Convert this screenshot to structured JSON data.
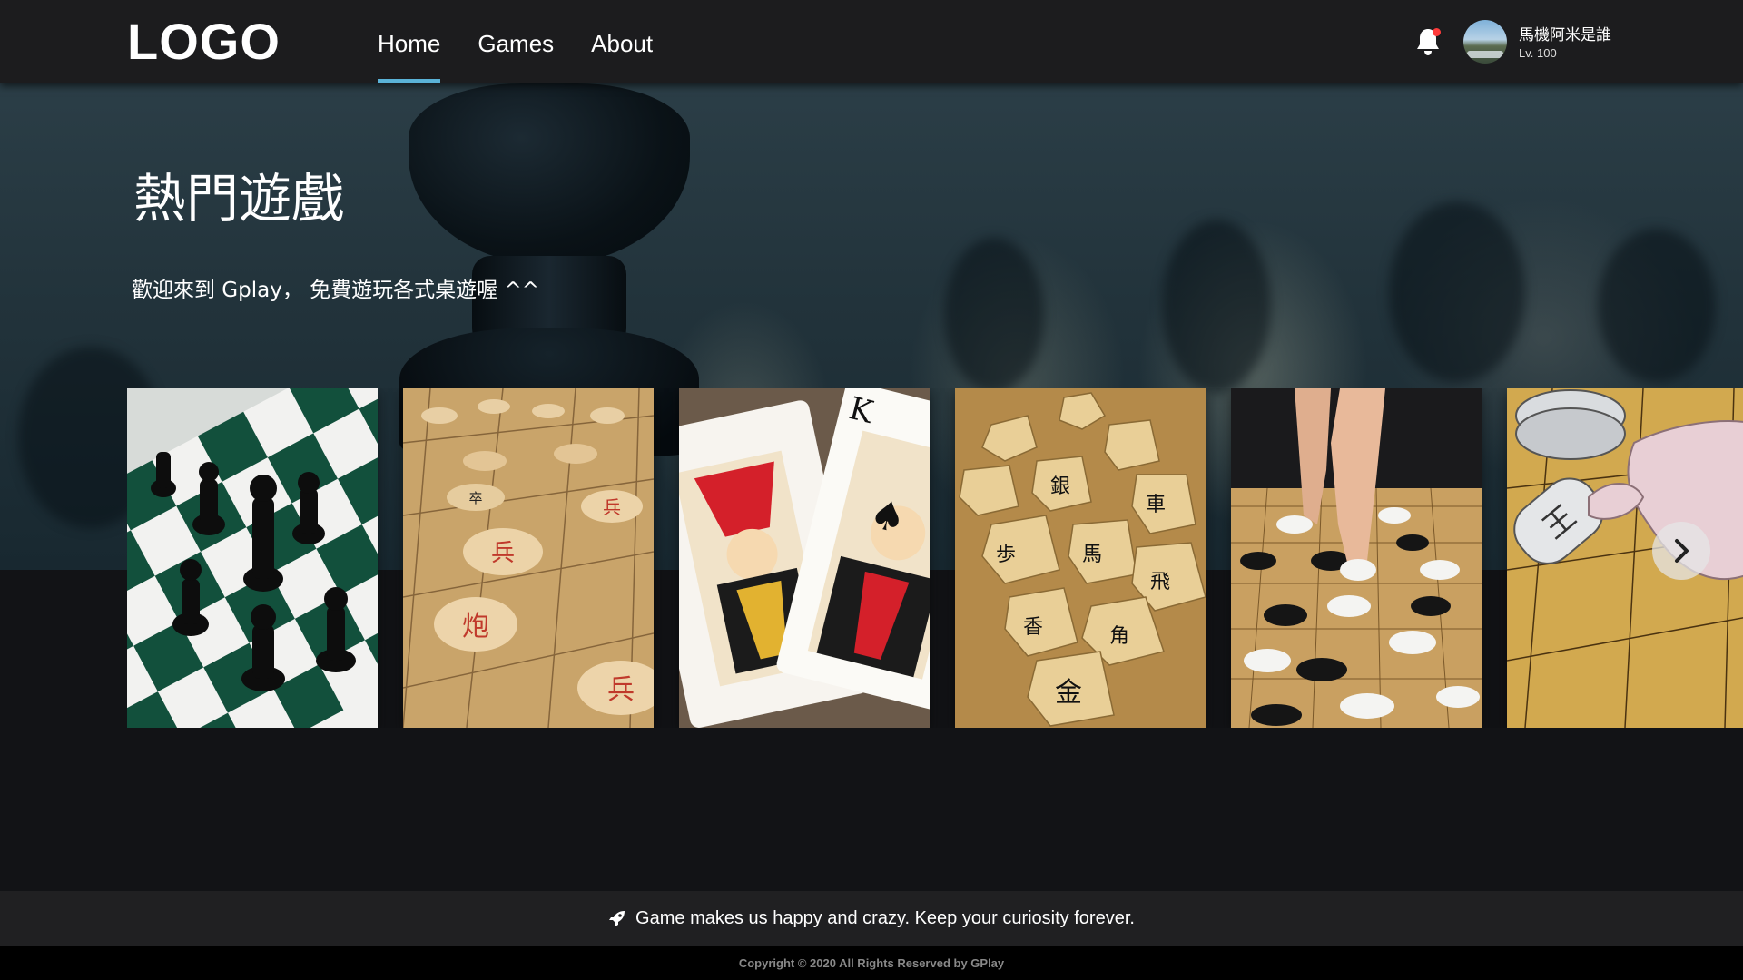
{
  "header": {
    "logo": "LOGO",
    "nav": [
      {
        "label": "Home",
        "active": true
      },
      {
        "label": "Games",
        "active": false
      },
      {
        "label": "About",
        "active": false
      }
    ],
    "notification_icon": "bell-icon",
    "user": {
      "name": "馬機阿米是誰",
      "level": "Lv. 100"
    },
    "accent_color": "#5ab3d8"
  },
  "hero": {
    "title": "熱門遊戲",
    "subtitle": "歡迎來到 Gplay， 免費遊玩各式桌遊喔 ^^"
  },
  "carousel": {
    "cards": [
      {
        "icon": "chess-image"
      },
      {
        "icon": "chinese-chess-image"
      },
      {
        "icon": "playing-cards-image"
      },
      {
        "icon": "shogi-image"
      },
      {
        "icon": "go-image"
      },
      {
        "icon": "anime-shogi-image"
      }
    ],
    "next_icon": "chevron-right-icon"
  },
  "footer": {
    "icon": "rocket-icon",
    "tagline": "Game makes us happy and crazy. Keep your curiosity forever.",
    "copyright": "Copyright © 2020 All Rights Reserved by GPlay"
  }
}
